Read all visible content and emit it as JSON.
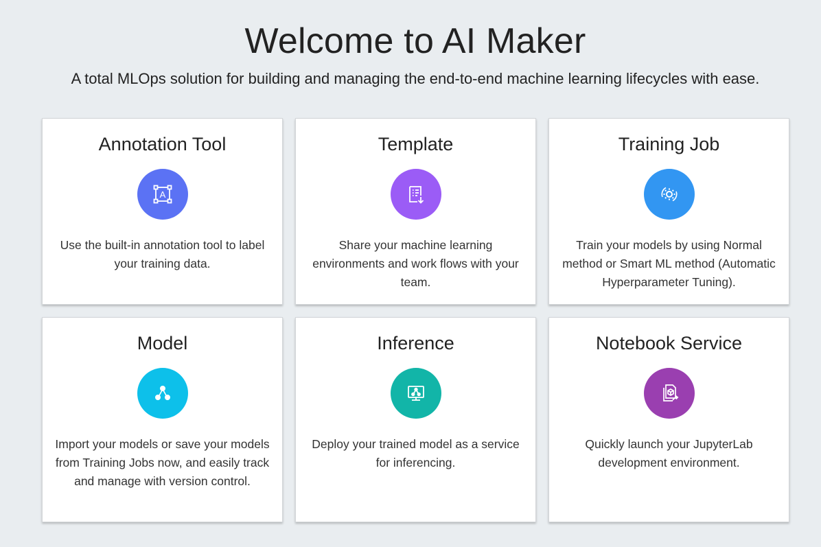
{
  "header": {
    "title": "Welcome to AI Maker",
    "subtitle": "A total MLOps solution for building and managing the end-to-end machine learning lifecycles with ease."
  },
  "cards": [
    {
      "title": "Annotation Tool",
      "description": "Use the built-in annotation tool to label your training data.",
      "icon": "annotation-icon",
      "color": "#5b72f4"
    },
    {
      "title": "Template",
      "description": "Share your machine learning environments and work flows with your team.",
      "icon": "template-icon",
      "color": "#9b5cf6"
    },
    {
      "title": "Training Job",
      "description": "Train your models by using Normal method or Smart ML method (Automatic Hyperparameter Tuning).",
      "icon": "training-job-icon",
      "color": "#3296f2"
    },
    {
      "title": "Model",
      "description": "Import your models or save your models from Training Jobs now, and easily track and manage with version control.",
      "icon": "model-icon",
      "color": "#0dc0ea"
    },
    {
      "title": "Inference",
      "description": "Deploy your trained model as a service for inferencing.",
      "icon": "inference-icon",
      "color": "#12b5a8"
    },
    {
      "title": "Notebook Service",
      "description": "Quickly launch your JupyterLab development environment.",
      "icon": "notebook-service-icon",
      "color": "#9a3fb0"
    }
  ]
}
